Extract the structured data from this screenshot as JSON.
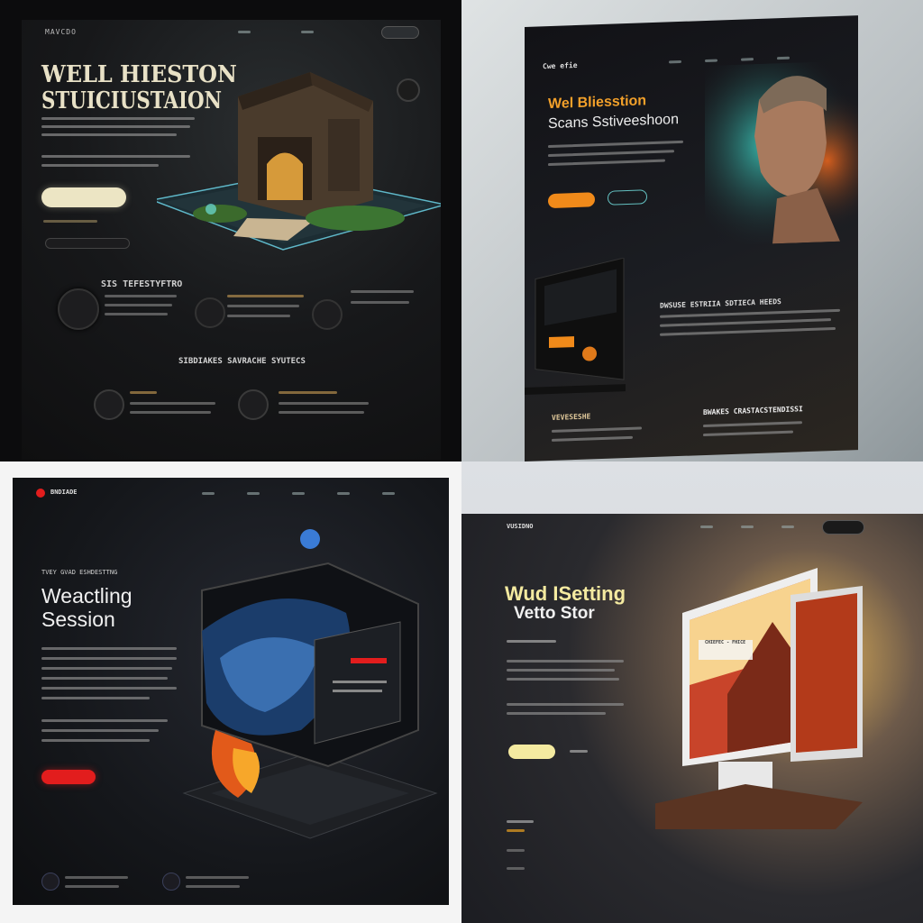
{
  "q1": {
    "logo": "MAVCDO",
    "title_line1": "WELL HIESTON",
    "title_line2": "STUICIUSTAION",
    "section_heading": "SIS TEFESTYFTRO",
    "section_heading2": "SIBDIAKES SAVRACHE SYUTECS",
    "colors": {
      "accent": "#e8dfb8",
      "bg": "#141415"
    }
  },
  "q2": {
    "logo": "Cwe efie",
    "title_line1": "Wel Bliesstion",
    "title_line2": "Scans Sstiveeshoon",
    "section_heading": "DWSUSE ESTRIIA SDTIECA HEEDS",
    "heading_bottom_left": "VEVESESHE",
    "heading_bottom_right": "BWAKES CRASTACSTENDISSI",
    "colors": {
      "accent": "#f08a1a"
    }
  },
  "q3": {
    "logo": "BNDIADE",
    "eyebrow": "TVEY GVAD ESHDESTTNG",
    "title_line1": "Weactling",
    "title_line2": "Session",
    "colors": {
      "accent": "#e21d1d"
    }
  },
  "q4": {
    "logo": "VUSIDNO",
    "title_line1": "Wud ISetting",
    "title_line2": "Vetto Stor",
    "mock_heading": "CHIEFEC - FHICE",
    "colors": {
      "accent": "#f4eaa0"
    }
  }
}
